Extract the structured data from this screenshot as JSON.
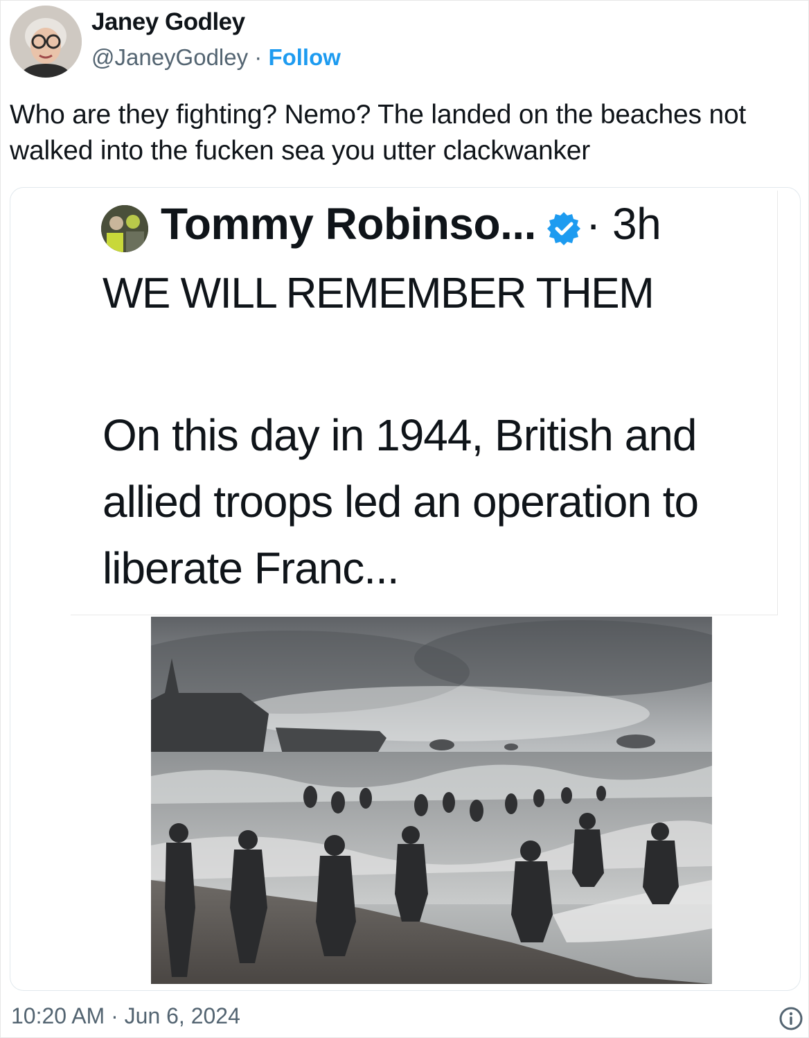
{
  "tweet": {
    "author_name": "Janey Godley",
    "handle": "@JaneyGodley",
    "separator": " · ",
    "follow_label": "Follow",
    "text": "Who are they fighting? Nemo? The landed on the beaches not walked into the fucken sea you utter clackwanker",
    "timestamp": "10:20 AM · Jun 6, 2024"
  },
  "quoted": {
    "author_name": "Tommy Robinso...",
    "time": "· 3h",
    "headline": "WE WILL REMEMBER THEM",
    "body": "On this day in 1944, British and allied troops led an operation to liberate Franc..."
  },
  "icons": {
    "verified": "verified-badge-icon",
    "info": "info-icon"
  },
  "colors": {
    "accent": "#1d9bf0",
    "text": "#0f1419",
    "muted": "#536471"
  }
}
